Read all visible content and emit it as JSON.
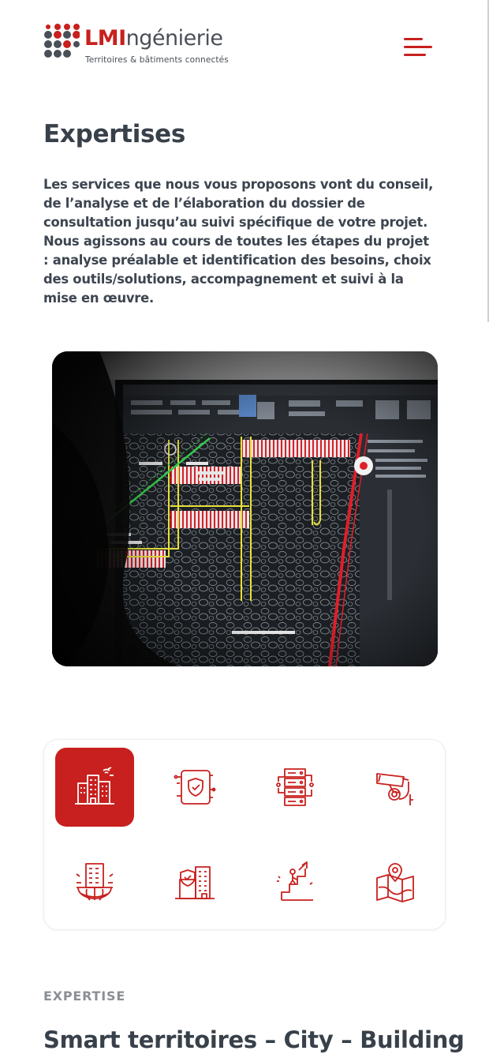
{
  "brand": {
    "name_bold": "LMI",
    "name_rest": "ngénierie",
    "tagline": "Territoires & bâtiments connectés",
    "primary_color": "#c8201e",
    "text_color": "#38404a"
  },
  "header": {
    "menu_icon": "hamburger-menu-icon"
  },
  "main": {
    "title": "Expertises",
    "intro": "Les services que nous vous proposons vont du conseil, de l’analyse et de l’élaboration du dossier de consultation jusqu’au suivi spécifique de votre projet. Nous agissons au cours de toutes les étapes du projet : analyse préalable et identification des besoins, choix des outils/solutions, accompagnement et suivi à la mise en œuvre.",
    "hero_image": "cad-drawing-on-monitor-photo"
  },
  "expertise_icons": [
    {
      "icon": "smart-city-building-icon",
      "active": true
    },
    {
      "icon": "cybersecurity-shield-icon",
      "active": false
    },
    {
      "icon": "server-rack-icon",
      "active": false
    },
    {
      "icon": "cctv-camera-icon",
      "active": false
    },
    {
      "icon": "global-city-network-icon",
      "active": false
    },
    {
      "icon": "secure-building-icon",
      "active": false
    },
    {
      "icon": "growth-steps-icon",
      "active": false
    },
    {
      "icon": "map-location-icon",
      "active": false
    }
  ],
  "section": {
    "eyebrow": "EXPERTISE",
    "title": "Smart territoires – City – Building"
  }
}
